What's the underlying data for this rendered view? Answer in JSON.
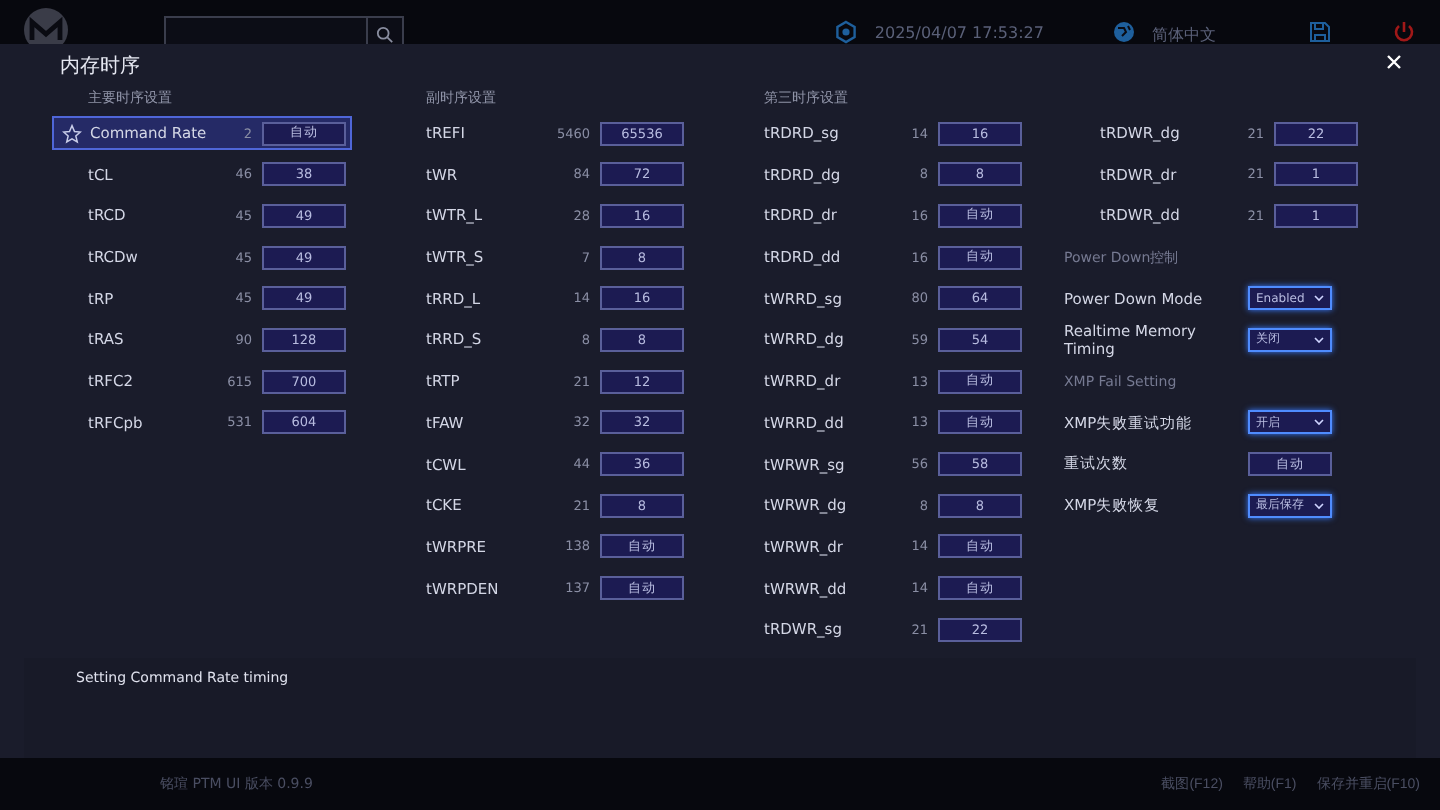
{
  "topbar": {
    "datetime": "2025/04/07 17:53:27",
    "language": "简体中文"
  },
  "dialog": {
    "title": "内存时序",
    "columns": [
      {
        "heading": "主要时序设置",
        "items": [
          {
            "kind": "timing",
            "label": "Command Rate",
            "current": "2",
            "value": "自动",
            "selected": true
          },
          {
            "kind": "timing",
            "label": "tCL",
            "current": "46",
            "value": "38",
            "selected": false
          },
          {
            "kind": "timing",
            "label": "tRCD",
            "current": "45",
            "value": "49",
            "selected": false
          },
          {
            "kind": "timing",
            "label": "tRCDw",
            "current": "45",
            "value": "49",
            "selected": false
          },
          {
            "kind": "timing",
            "label": "tRP",
            "current": "45",
            "value": "49",
            "selected": false
          },
          {
            "kind": "timing",
            "label": "tRAS",
            "current": "90",
            "value": "128",
            "selected": false
          },
          {
            "kind": "timing",
            "label": "tRFC2",
            "current": "615",
            "value": "700",
            "selected": false
          },
          {
            "kind": "timing",
            "label": "tRFCpb",
            "current": "531",
            "value": "604",
            "selected": false
          }
        ]
      },
      {
        "heading": "副时序设置",
        "items": [
          {
            "kind": "timing",
            "label": "tREFI",
            "current": "5460",
            "value": "65536",
            "selected": false
          },
          {
            "kind": "timing",
            "label": "tWR",
            "current": "84",
            "value": "72",
            "selected": false
          },
          {
            "kind": "timing",
            "label": "tWTR_L",
            "current": "28",
            "value": "16",
            "selected": false
          },
          {
            "kind": "timing",
            "label": "tWTR_S",
            "current": "7",
            "value": "8",
            "selected": false
          },
          {
            "kind": "timing",
            "label": "tRRD_L",
            "current": "14",
            "value": "16",
            "selected": false
          },
          {
            "kind": "timing",
            "label": "tRRD_S",
            "current": "8",
            "value": "8",
            "selected": false
          },
          {
            "kind": "timing",
            "label": "tRTP",
            "current": "21",
            "value": "12",
            "selected": false
          },
          {
            "kind": "timing",
            "label": "tFAW",
            "current": "32",
            "value": "32",
            "selected": false
          },
          {
            "kind": "timing",
            "label": "tCWL",
            "current": "44",
            "value": "36",
            "selected": false
          },
          {
            "kind": "timing",
            "label": "tCKE",
            "current": "21",
            "value": "8",
            "selected": false
          },
          {
            "kind": "timing",
            "label": "tWRPRE",
            "current": "138",
            "value": "自动",
            "selected": false
          },
          {
            "kind": "timing",
            "label": "tWRPDEN",
            "current": "137",
            "value": "自动",
            "selected": false
          }
        ]
      },
      {
        "heading": "第三时序设置",
        "items": [
          {
            "kind": "timing",
            "label": "tRDRD_sg",
            "current": "14",
            "value": "16",
            "selected": false
          },
          {
            "kind": "timing",
            "label": "tRDRD_dg",
            "current": "8",
            "value": "8",
            "selected": false
          },
          {
            "kind": "timing",
            "label": "tRDRD_dr",
            "current": "16",
            "value": "自动",
            "selected": false
          },
          {
            "kind": "timing",
            "label": "tRDRD_dd",
            "current": "16",
            "value": "自动",
            "selected": false
          },
          {
            "kind": "timing",
            "label": "tWRRD_sg",
            "current": "80",
            "value": "64",
            "selected": false
          },
          {
            "kind": "timing",
            "label": "tWRRD_dg",
            "current": "59",
            "value": "54",
            "selected": false
          },
          {
            "kind": "timing",
            "label": "tWRRD_dr",
            "current": "13",
            "value": "自动",
            "selected": false
          },
          {
            "kind": "timing",
            "label": "tWRRD_dd",
            "current": "13",
            "value": "自动",
            "selected": false
          },
          {
            "kind": "timing",
            "label": "tWRWR_sg",
            "current": "56",
            "value": "58",
            "selected": false
          },
          {
            "kind": "timing",
            "label": "tWRWR_dg",
            "current": "8",
            "value": "8",
            "selected": false
          },
          {
            "kind": "timing",
            "label": "tWRWR_dr",
            "current": "14",
            "value": "自动",
            "selected": false
          },
          {
            "kind": "timing",
            "label": "tWRWR_dd",
            "current": "14",
            "value": "自动",
            "selected": false
          },
          {
            "kind": "timing",
            "label": "tRDWR_sg",
            "current": "21",
            "value": "22",
            "selected": false
          }
        ]
      },
      {
        "items": [
          {
            "kind": "timing",
            "label": "tRDWR_dg",
            "current": "21",
            "value": "22",
            "selected": false
          },
          {
            "kind": "timing",
            "label": "tRDWR_dr",
            "current": "21",
            "value": "1",
            "selected": false
          },
          {
            "kind": "timing",
            "label": "tRDWR_dd",
            "current": "21",
            "value": "1",
            "selected": false
          },
          {
            "kind": "heading",
            "label": "Power Down控制"
          },
          {
            "kind": "select",
            "label": "Power Down Mode",
            "value": "Enabled"
          },
          {
            "kind": "select",
            "label": "Realtime Memory Timing",
            "value": "关闭"
          },
          {
            "kind": "heading",
            "label": "XMP Fail Setting"
          },
          {
            "kind": "select",
            "label": "XMP失败重试功能",
            "value": "开启"
          },
          {
            "kind": "button",
            "label": "重试次数",
            "value": "自动"
          },
          {
            "kind": "select",
            "label": "XMP失败恢复",
            "value": "最后保存"
          }
        ]
      }
    ],
    "description": "Setting Command Rate timing"
  },
  "footer": {
    "version": "铭瑄 PTM UI 版本 0.9.9",
    "actions": [
      "截图(F12)",
      "帮助(F1)",
      "保存并重启(F10)"
    ]
  }
}
